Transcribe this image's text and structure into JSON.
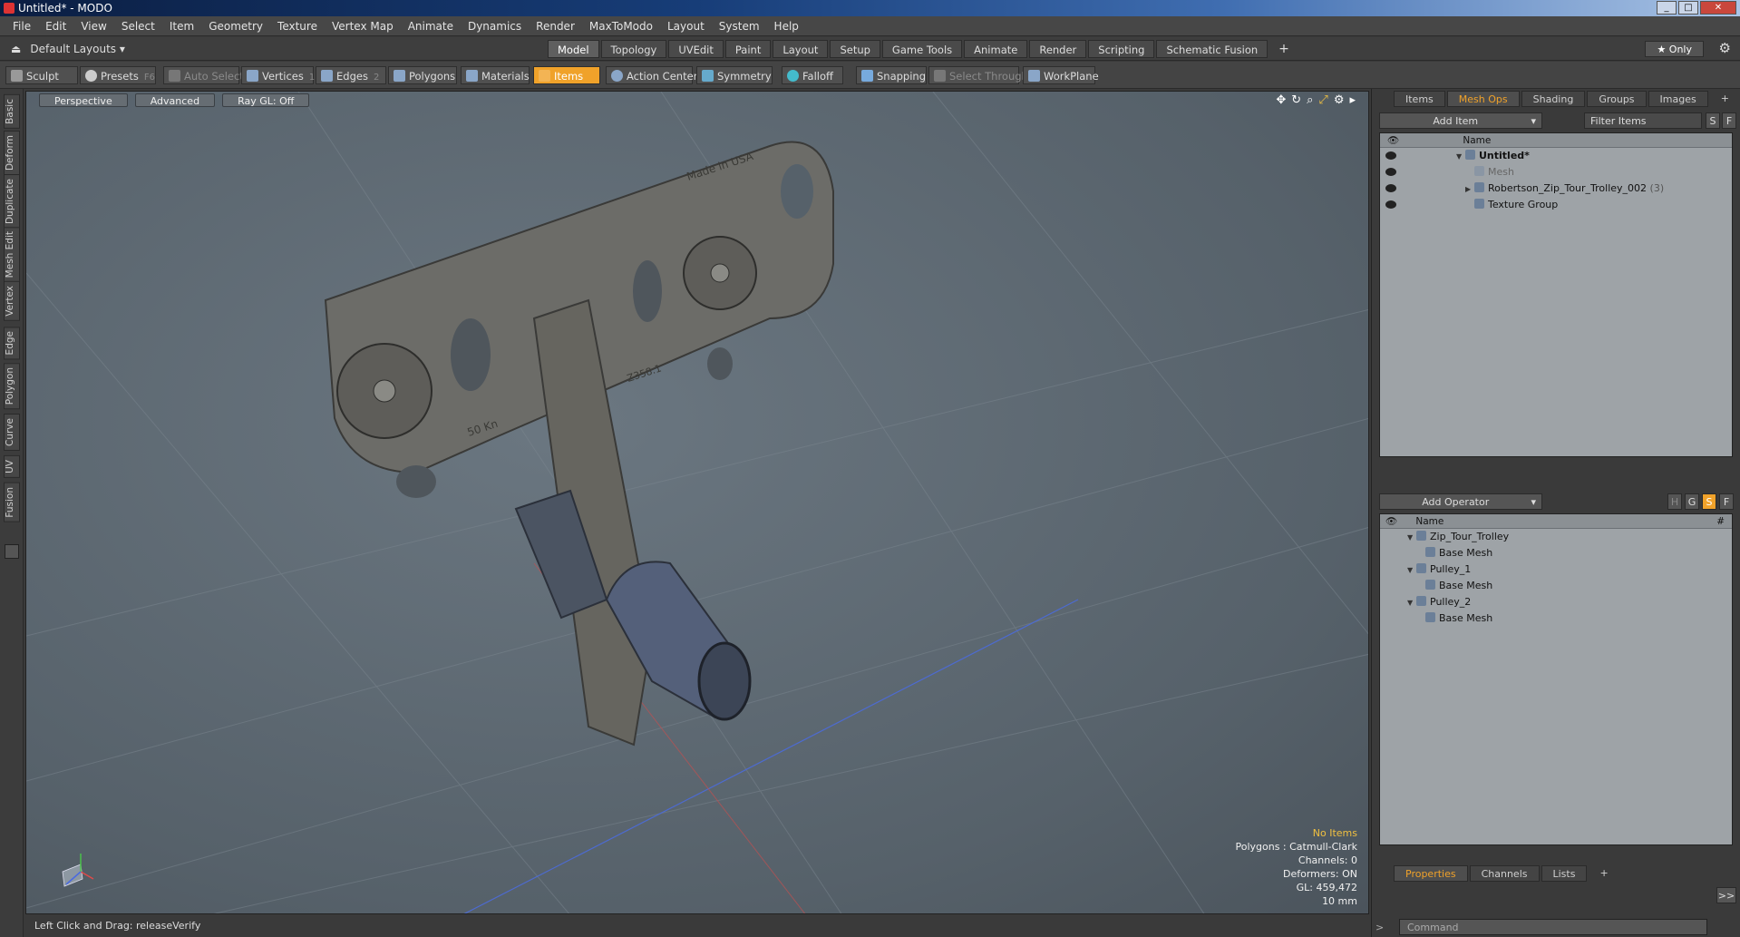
{
  "window": {
    "title": "Untitled* - MODO",
    "min": "_",
    "max": "□",
    "close": "✕"
  },
  "menu": [
    "File",
    "Edit",
    "View",
    "Select",
    "Item",
    "Geometry",
    "Texture",
    "Vertex Map",
    "Animate",
    "Dynamics",
    "Render",
    "MaxToModo",
    "Layout",
    "System",
    "Help"
  ],
  "layouts": {
    "label": "Default Layouts ▾"
  },
  "mode_tabs": [
    "Model",
    "Topology",
    "UVEdit",
    "Paint",
    "Layout",
    "Setup",
    "Game Tools",
    "Animate",
    "Render",
    "Scripting",
    "Schematic Fusion"
  ],
  "add_tab": "+",
  "only_label": "★  Only",
  "toolbar": {
    "sculpt": "Sculpt",
    "presets": "Presets",
    "presets_key": "F6",
    "auto_select": "Auto Select",
    "vertices": "Vertices",
    "vertices_n": "1",
    "edges": "Edges",
    "edges_n": "2",
    "polygons": "Polygons",
    "materials": "Materials",
    "items": "Items",
    "action_center": "Action Center",
    "symmetry": "Symmetry",
    "falloff": "Falloff",
    "snapping": "Snapping",
    "select_through": "Select Through",
    "workplane": "WorkPlane"
  },
  "left_tabs": [
    "Basic",
    "Deform",
    "Duplicate",
    "Mesh Edit",
    "Vertex",
    "Edge",
    "Polygon",
    "Curve",
    "UV",
    "Fusion"
  ],
  "viewport": {
    "view": "Perspective",
    "advanced": "Advanced",
    "raygl": "Ray GL: Off",
    "stamp1": "Made in USA",
    "stamp2": "50 Kn",
    "stamp3": "Z358.1",
    "stats": {
      "items": "No Items",
      "polygons": "Polygons : Catmull-Clark",
      "channels": "Channels: 0",
      "deformers": "Deformers: ON",
      "gl": "GL: 459,472",
      "scale": "10 mm"
    }
  },
  "status": {
    "text": "Left Click and Drag:   releaseVerify"
  },
  "items_panel": {
    "tabs": [
      "Items",
      "Mesh Ops",
      "Shading",
      "Groups",
      "Images",
      "+"
    ],
    "add_item": "Add Item",
    "filter": "Filter Items",
    "s": "S",
    "f": "F",
    "col_name": "Name",
    "rows": [
      {
        "label": "Untitled*",
        "level": 0
      },
      {
        "label": "Mesh",
        "level": 1
      },
      {
        "label": "Robertson_Zip_Tour_Trolley_002",
        "count": "(3)",
        "level": 1
      },
      {
        "label": "Texture Group",
        "level": 1
      }
    ]
  },
  "ops_panel": {
    "add_operator": "Add Operator",
    "h": "H",
    "g": "G",
    "s": "S",
    "f": "F",
    "col_name": "Name",
    "col_hash": "#",
    "rows": [
      {
        "label": "Zip_Tour_Trolley",
        "level": 0
      },
      {
        "label": "Base Mesh",
        "level": 1
      },
      {
        "label": "Pulley_1",
        "level": 0
      },
      {
        "label": "Base Mesh",
        "level": 1
      },
      {
        "label": "Pulley_2",
        "level": 0
      },
      {
        "label": "Base Mesh",
        "level": 1
      }
    ]
  },
  "props_panel": {
    "tabs": [
      "Properties",
      "Channels",
      "Lists",
      "+"
    ],
    "expand": ">>"
  },
  "command": {
    "placeholder": "Command"
  },
  "colors": {
    "accent": "#f0a22a"
  }
}
